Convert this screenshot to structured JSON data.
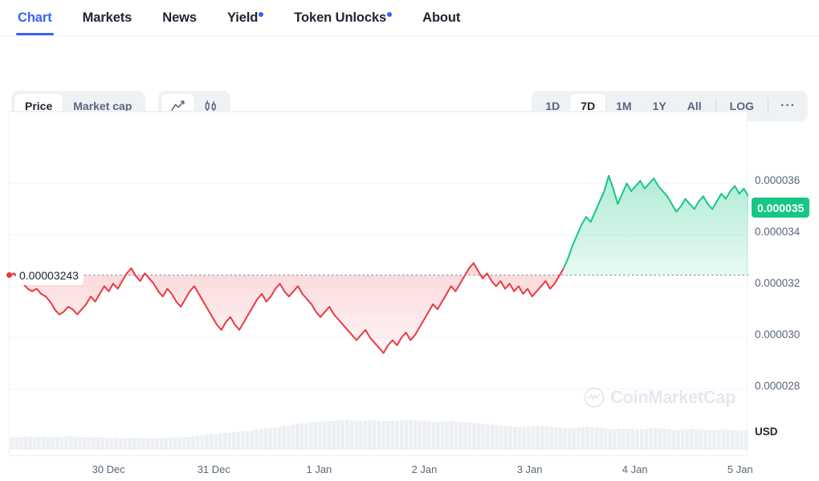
{
  "tabs": [
    {
      "label": "Chart",
      "active": true,
      "badge": false
    },
    {
      "label": "Markets",
      "active": false,
      "badge": false
    },
    {
      "label": "News",
      "active": false,
      "badge": false
    },
    {
      "label": "Yield",
      "active": false,
      "badge": true
    },
    {
      "label": "Token Unlocks",
      "active": false,
      "badge": true
    },
    {
      "label": "About",
      "active": false,
      "badge": false
    }
  ],
  "toolbar": {
    "metric_options": [
      {
        "label": "Price",
        "active": true
      },
      {
        "label": "Market cap",
        "active": false
      }
    ],
    "chart_type": [
      {
        "icon": "line-chart-icon",
        "active": true
      },
      {
        "icon": "candlestick-icon",
        "active": false
      }
    ],
    "ranges": [
      {
        "label": "1D",
        "active": false
      },
      {
        "label": "7D",
        "active": true
      },
      {
        "label": "1M",
        "active": false
      },
      {
        "label": "1Y",
        "active": false
      },
      {
        "label": "All",
        "active": false
      }
    ],
    "log_label": "LOG",
    "more_label": "···"
  },
  "watermark": "CoinMarketCap",
  "reference": {
    "label": "0.00003243",
    "value": 3.243e-05
  },
  "current_price_badge": "0.000035",
  "currency": "USD",
  "colors": {
    "up": "#16c784",
    "down": "#ea3943",
    "accent": "#3861fb",
    "grid": "#f3f5f8",
    "volume": "#eceff3",
    "text_muted": "#58667e"
  },
  "chart_data": {
    "type": "area",
    "title": "",
    "xlabel": "",
    "ylabel": "",
    "currency": "USD",
    "range": "7D",
    "scale": "linear",
    "grid": true,
    "legend": null,
    "ylim": [
      2.72e-05,
      3.72e-05
    ],
    "y_ticks": [
      3.6e-05,
      3.4e-05,
      3.2e-05,
      3e-05,
      2.8e-05
    ],
    "y_tick_labels": [
      "0.000036",
      "0.000034",
      "0.000032",
      "0.000030",
      "0.000028"
    ],
    "x_tick_labels": [
      "30 Dec",
      "31 Dec",
      "1 Jan",
      "2 Jan",
      "3 Jan",
      "4 Jan",
      "5 Jan"
    ],
    "x_tick_positions": [
      0.135,
      0.2775,
      0.42,
      0.5625,
      0.705,
      0.8475,
      0.99
    ],
    "reference_line": 3.243e-05,
    "reference_line_label": "0.00003243",
    "last_value": 3.5e-05,
    "series": [
      {
        "name": "Price",
        "color_below_reference": "#ea3943",
        "color_above_reference": "#16c784",
        "values": [
          3.24e-05,
          3.25e-05,
          3.23e-05,
          3.21e-05,
          3.19e-05,
          3.18e-05,
          3.19e-05,
          3.17e-05,
          3.16e-05,
          3.14e-05,
          3.11e-05,
          3.09e-05,
          3.1e-05,
          3.12e-05,
          3.11e-05,
          3.09e-05,
          3.11e-05,
          3.13e-05,
          3.16e-05,
          3.14e-05,
          3.17e-05,
          3.2e-05,
          3.18e-05,
          3.21e-05,
          3.19e-05,
          3.22e-05,
          3.25e-05,
          3.27e-05,
          3.24e-05,
          3.22e-05,
          3.25e-05,
          3.23e-05,
          3.21e-05,
          3.18e-05,
          3.16e-05,
          3.19e-05,
          3.17e-05,
          3.14e-05,
          3.12e-05,
          3.15e-05,
          3.18e-05,
          3.2e-05,
          3.17e-05,
          3.14e-05,
          3.11e-05,
          3.08e-05,
          3.05e-05,
          3.03e-05,
          3.06e-05,
          3.08e-05,
          3.05e-05,
          3.03e-05,
          3.06e-05,
          3.09e-05,
          3.12e-05,
          3.15e-05,
          3.17e-05,
          3.14e-05,
          3.16e-05,
          3.19e-05,
          3.21e-05,
          3.18e-05,
          3.16e-05,
          3.18e-05,
          3.2e-05,
          3.17e-05,
          3.15e-05,
          3.13e-05,
          3.1e-05,
          3.08e-05,
          3.1e-05,
          3.12e-05,
          3.09e-05,
          3.07e-05,
          3.05e-05,
          3.03e-05,
          3.01e-05,
          2.99e-05,
          3.01e-05,
          3.03e-05,
          3e-05,
          2.98e-05,
          2.96e-05,
          2.94e-05,
          2.97e-05,
          2.99e-05,
          2.97e-05,
          3e-05,
          3.02e-05,
          2.99e-05,
          3.01e-05,
          3.04e-05,
          3.07e-05,
          3.1e-05,
          3.13e-05,
          3.11e-05,
          3.14e-05,
          3.17e-05,
          3.2e-05,
          3.18e-05,
          3.21e-05,
          3.24e-05,
          3.27e-05,
          3.29e-05,
          3.26e-05,
          3.23e-05,
          3.25e-05,
          3.22e-05,
          3.2e-05,
          3.22e-05,
          3.19e-05,
          3.21e-05,
          3.18e-05,
          3.2e-05,
          3.17e-05,
          3.19e-05,
          3.16e-05,
          3.18e-05,
          3.2e-05,
          3.22e-05,
          3.19e-05,
          3.21e-05,
          3.24e-05,
          3.27e-05,
          3.31e-05,
          3.36e-05,
          3.4e-05,
          3.44e-05,
          3.47e-05,
          3.45e-05,
          3.49e-05,
          3.53e-05,
          3.57e-05,
          3.63e-05,
          3.58e-05,
          3.52e-05,
          3.56e-05,
          3.6e-05,
          3.57e-05,
          3.59e-05,
          3.61e-05,
          3.58e-05,
          3.6e-05,
          3.62e-05,
          3.59e-05,
          3.57e-05,
          3.55e-05,
          3.52e-05,
          3.49e-05,
          3.51e-05,
          3.54e-05,
          3.52e-05,
          3.5e-05,
          3.53e-05,
          3.55e-05,
          3.52e-05,
          3.5e-05,
          3.53e-05,
          3.56e-05,
          3.54e-05,
          3.57e-05,
          3.59e-05,
          3.56e-05,
          3.58e-05,
          3.55e-05
        ]
      }
    ],
    "volume": {
      "name": "Volume",
      "color": "#eceff3",
      "values": [
        0.3,
        0.31,
        0.3,
        0.32,
        0.31,
        0.3,
        0.31,
        0.32,
        0.31,
        0.3,
        0.31,
        0.3,
        0.32,
        0.33,
        0.32,
        0.31,
        0.3,
        0.29,
        0.3,
        0.31,
        0.3,
        0.29,
        0.28,
        0.29,
        0.28,
        0.27,
        0.28,
        0.29,
        0.28,
        0.27,
        0.28,
        0.27,
        0.28,
        0.29,
        0.28,
        0.29,
        0.3,
        0.29,
        0.3,
        0.31,
        0.32,
        0.33,
        0.34,
        0.36,
        0.38,
        0.37,
        0.39,
        0.41,
        0.4,
        0.42,
        0.43,
        0.45,
        0.44,
        0.46,
        0.48,
        0.5,
        0.52,
        0.51,
        0.53,
        0.55,
        0.57,
        0.58,
        0.6,
        0.62,
        0.64,
        0.63,
        0.65,
        0.67,
        0.66,
        0.68,
        0.7,
        0.69,
        0.71,
        0.7,
        0.72,
        0.71,
        0.7,
        0.69,
        0.7,
        0.71,
        0.7,
        0.69,
        0.68,
        0.69,
        0.7,
        0.69,
        0.7,
        0.71,
        0.72,
        0.71,
        0.7,
        0.69,
        0.68,
        0.67,
        0.66,
        0.67,
        0.68,
        0.69,
        0.68,
        0.67,
        0.66,
        0.65,
        0.64,
        0.63,
        0.62,
        0.61,
        0.6,
        0.59,
        0.58,
        0.57,
        0.56,
        0.55,
        0.54,
        0.55,
        0.56,
        0.57,
        0.58,
        0.57,
        0.56,
        0.55,
        0.54,
        0.53,
        0.52,
        0.51,
        0.52,
        0.53,
        0.54,
        0.55,
        0.54,
        0.53,
        0.52,
        0.51,
        0.5,
        0.49,
        0.5,
        0.51,
        0.5,
        0.49,
        0.48,
        0.49,
        0.5,
        0.51,
        0.52,
        0.51,
        0.5,
        0.49,
        0.48,
        0.47,
        0.48,
        0.49,
        0.5,
        0.49,
        0.48,
        0.47,
        0.46,
        0.47,
        0.48,
        0.49,
        0.48,
        0.47,
        0.46,
        0.45,
        0.46
      ]
    }
  }
}
